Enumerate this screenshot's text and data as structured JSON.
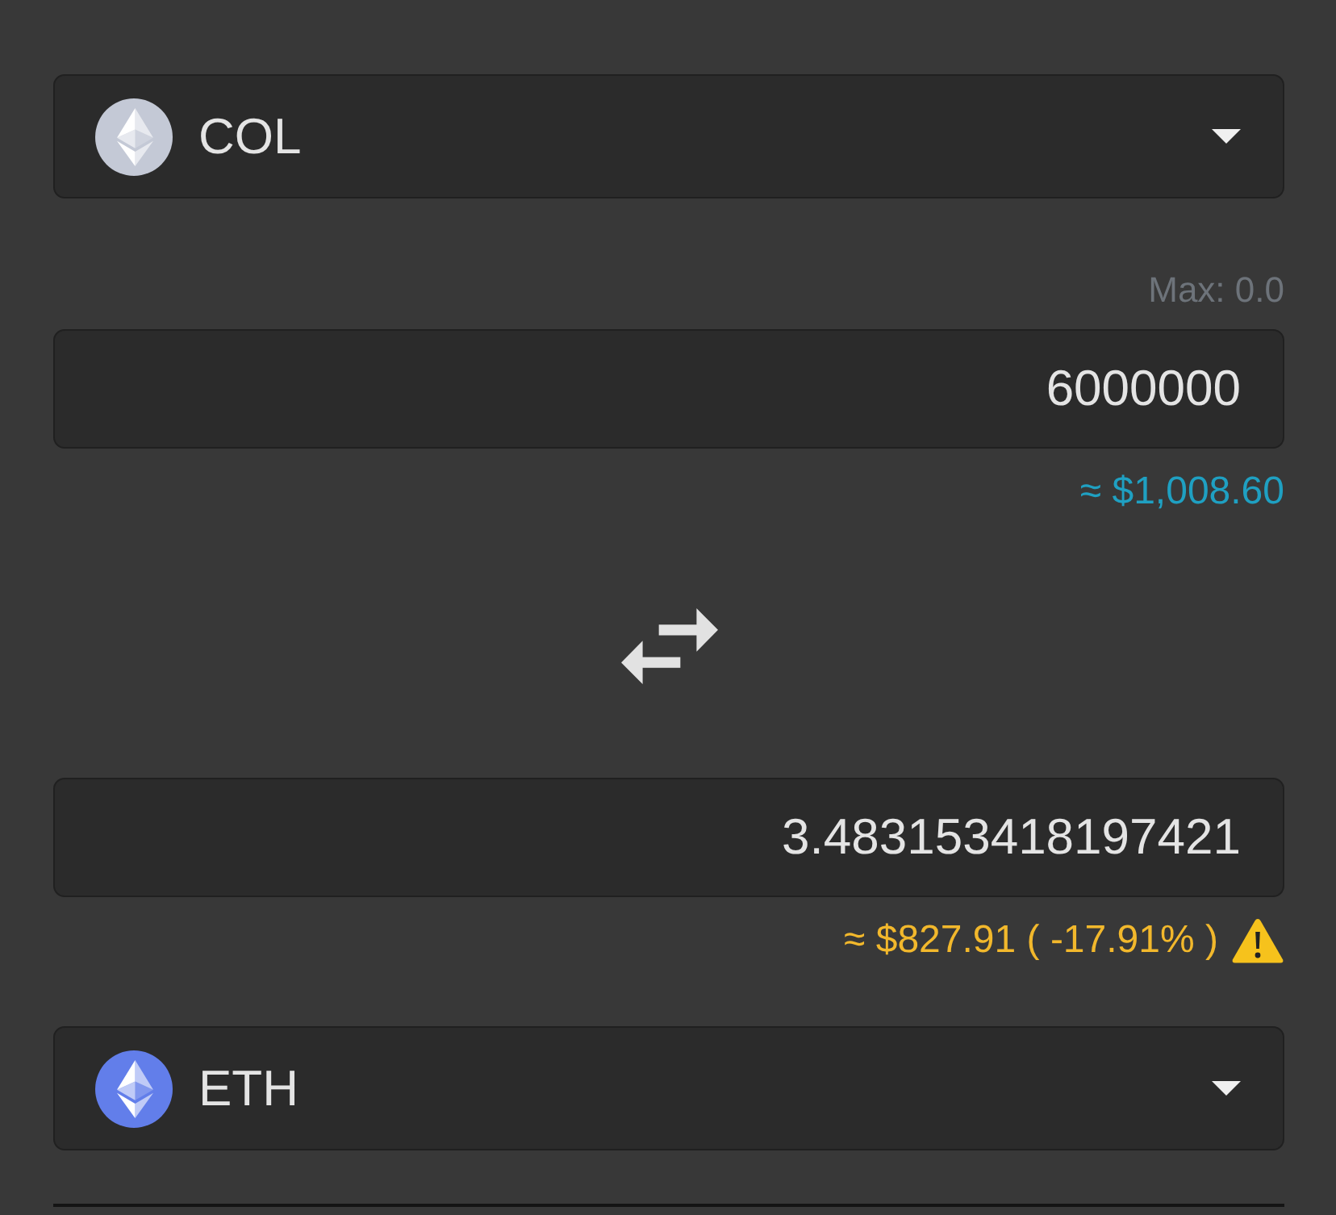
{
  "from": {
    "token": {
      "symbol": "COL",
      "color": "#c4c9d6"
    },
    "max_label": "Max: 0.0",
    "amount": "6000000",
    "usd_value": "≈ $1,008.60",
    "warning": false
  },
  "to": {
    "amount": "3.483153418197421",
    "usd_value": "≈ $827.91 ( -17.91% )",
    "warning": true,
    "token": {
      "symbol": "ETH",
      "color": "#627eea"
    }
  }
}
